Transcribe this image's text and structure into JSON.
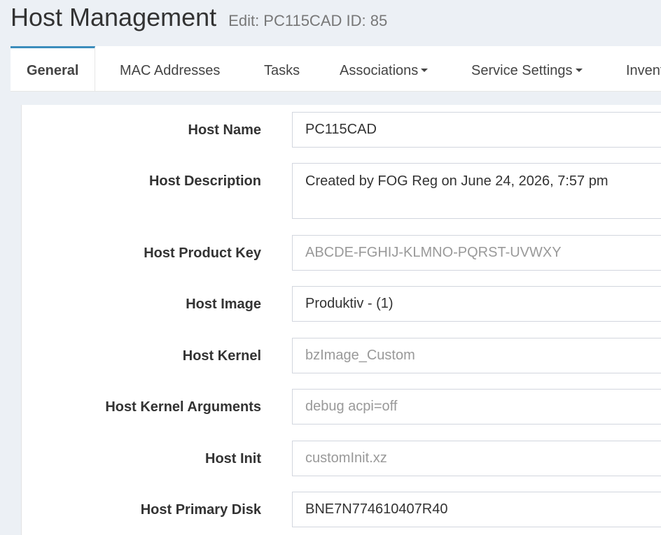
{
  "header": {
    "title": "Host Management",
    "subtitle": "Edit: PC115CAD ID: 85"
  },
  "tabs": [
    {
      "label": "General",
      "active": true
    },
    {
      "label": "MAC Addresses"
    },
    {
      "label": "Tasks"
    },
    {
      "label": "Associations",
      "dropdown": true
    },
    {
      "label": "Service Settings",
      "dropdown": true
    },
    {
      "label": "Inventory"
    }
  ],
  "form": {
    "host_name": {
      "label": "Host Name",
      "value": "PC115CAD"
    },
    "host_description": {
      "label": "Host Description",
      "value": "Created by FOG Reg on June 24, 2026, 7:57 pm"
    },
    "host_product_key": {
      "label": "Host Product Key",
      "placeholder": "ABCDE-FGHIJ-KLMNO-PQRST-UVWXY"
    },
    "host_image": {
      "label": "Host Image",
      "value": "Produktiv - (1)"
    },
    "host_kernel": {
      "label": "Host Kernel",
      "placeholder": "bzImage_Custom"
    },
    "host_kernel_arguments": {
      "label": "Host Kernel Arguments",
      "placeholder": "debug acpi=off"
    },
    "host_init": {
      "label": "Host Init",
      "placeholder": "customInit.xz"
    },
    "host_primary_disk": {
      "label": "Host Primary Disk",
      "value": "BNE7N774610407R40"
    }
  },
  "colors": {
    "accent": "#3c8dbc",
    "background": "#ecf0f5",
    "placeholder": "#999999"
  }
}
